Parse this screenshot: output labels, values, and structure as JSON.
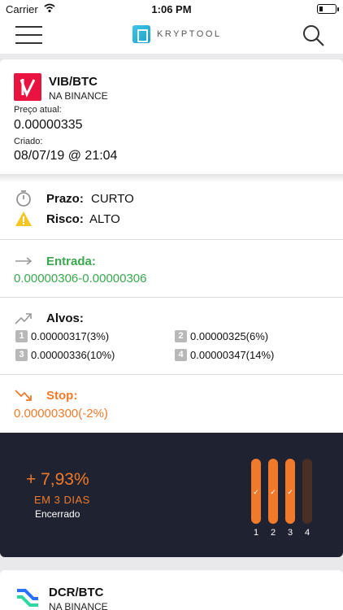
{
  "status_bar": {
    "carrier": "Carrier",
    "time": "1:06 PM"
  },
  "nav": {
    "logo_text": "KRYPTOOL"
  },
  "signal": {
    "pair": "VIB/BTC",
    "exchange": "NA BINANCE",
    "current_price_label": "Preço atual:",
    "current_price": "0.00000335",
    "created_label": "Criado:",
    "created": "08/07/19 @ 21:04",
    "term_label": "Prazo:",
    "term_value": "CURTO",
    "risk_label": "Risco:",
    "risk_value": "ALTO",
    "entry_label": "Entrada:",
    "entry_value": "0.00000306-0.00000306",
    "targets_label": "Alvos:",
    "targets": [
      {
        "num": "1",
        "value": "0.00000317(3%)"
      },
      {
        "num": "2",
        "value": "0.00000325(6%)"
      },
      {
        "num": "3",
        "value": "0.00000336(10%)"
      },
      {
        "num": "4",
        "value": "0.00000347(14%)"
      }
    ],
    "stop_label": "Stop:",
    "stop_value": "0.00000300(-2%)",
    "result": {
      "percent": "+ 7,93%",
      "days": "EM 3 DIAS",
      "status": "Encerrado",
      "targets_hit": 3,
      "bar_labels": [
        "1",
        "2",
        "3",
        "4"
      ]
    },
    "colors": {
      "accent": "#f07a2a",
      "entry": "#3aa84d",
      "panel": "#1f2331",
      "coin_logo": "#e8133f"
    }
  },
  "next_signal": {
    "pair": "DCR/BTC",
    "exchange": "NA BINANCE"
  }
}
